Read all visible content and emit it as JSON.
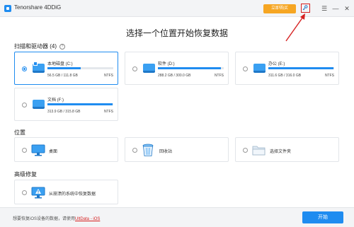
{
  "window": {
    "app_title": "Tenorshare 4DDiG",
    "buy_label": "立即购买",
    "key_icon": "key-icon",
    "menu_glyph": "☰",
    "minimize_glyph": "—",
    "close_glyph": "✕"
  },
  "main_title": "选择一个位置开始恢复数据",
  "drives_section": {
    "title": "扫描和驱动器 (4)",
    "help_glyph": "?",
    "drives": [
      {
        "name": "本地磁盘 (C:)",
        "size": "56.5 GB / 111.8 GB",
        "fs": "NTFS",
        "used_fraction": 0.51,
        "selected": true
      },
      {
        "name": "软件 (D:)",
        "size": "288.2 GB / 300.0 GB",
        "fs": "NTFS",
        "used_fraction": 0.96,
        "selected": false
      },
      {
        "name": "办公 (E:)",
        "size": "311.6 GB / 316.0 GB",
        "fs": "NTFS",
        "used_fraction": 0.99,
        "selected": false
      },
      {
        "name": "文档 (F:)",
        "size": "313.9 GB / 315.8 GB",
        "fs": "NTFS",
        "used_fraction": 0.99,
        "selected": false
      }
    ]
  },
  "location_section": {
    "title": "位置",
    "items": [
      {
        "label": "桌面",
        "icon": "desktop-icon"
      },
      {
        "label": "回收站",
        "icon": "recycle-bin-icon"
      },
      {
        "label": "选择文件夹",
        "icon": "folder-icon"
      }
    ]
  },
  "advanced_section": {
    "title": "高级修复",
    "items": [
      {
        "label": "从崩溃的系统中恢复数据",
        "icon": "crashed-system-icon"
      }
    ]
  },
  "footer": {
    "text": "想要恢复iOS设备的数据，请使用",
    "link": "UltData - iOS",
    "start_label": "开始"
  },
  "colors": {
    "accent": "#1f8cf0",
    "buy": "#f6a623",
    "highlight": "#d62020"
  }
}
